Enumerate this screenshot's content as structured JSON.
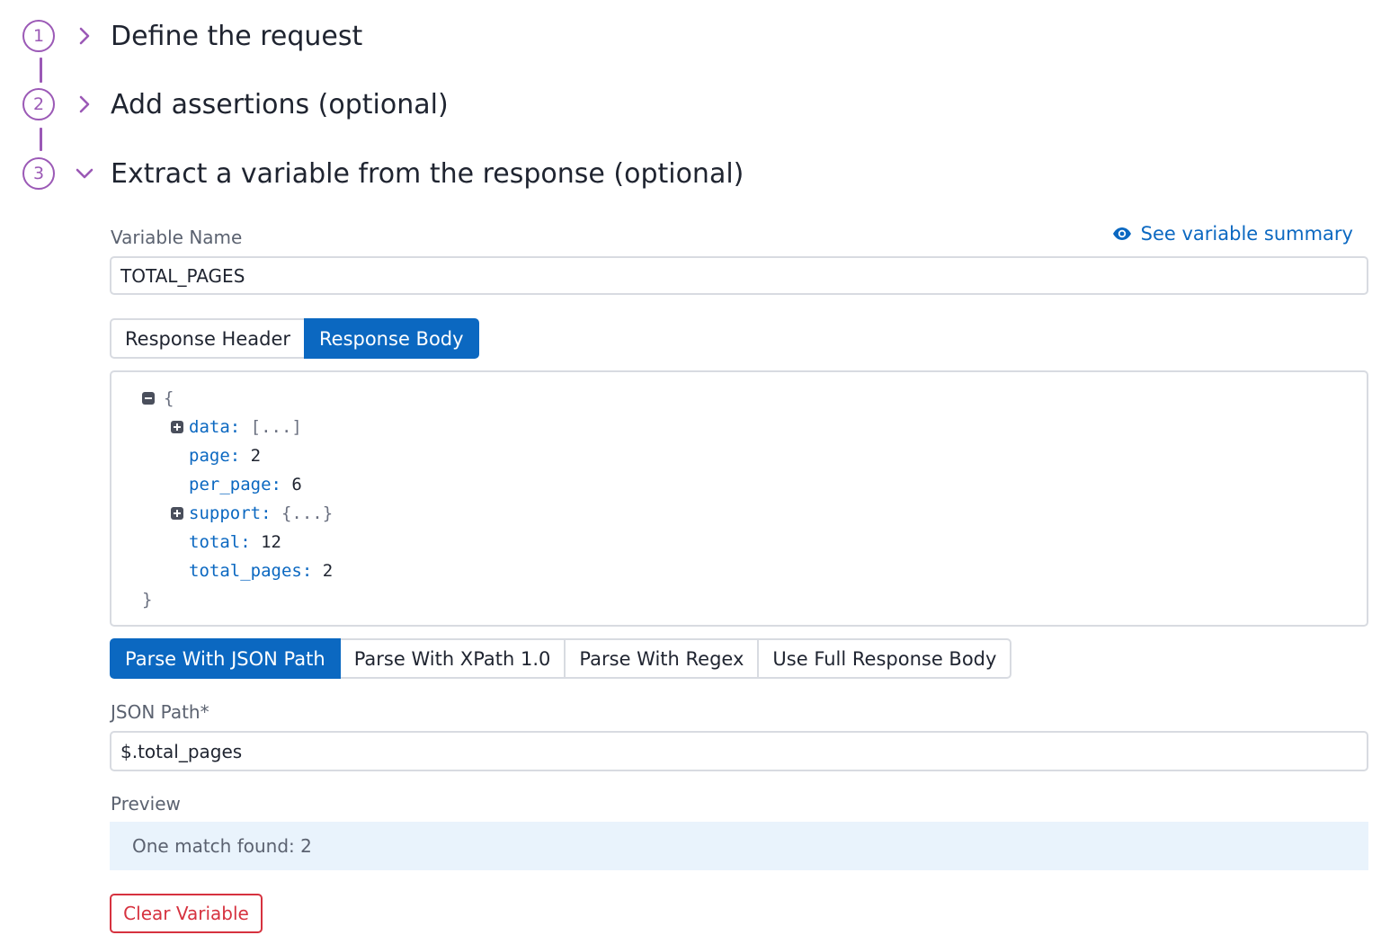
{
  "steps": [
    {
      "number": "1",
      "title": "Define the request",
      "expanded": false
    },
    {
      "number": "2",
      "title": "Add assertions (optional)",
      "expanded": false
    },
    {
      "number": "3",
      "title": "Extract a variable from the response (optional)",
      "expanded": true
    }
  ],
  "variable": {
    "label": "Variable Name",
    "value": "TOTAL_PAGES",
    "summary_link": "See variable summary"
  },
  "source_tabs": {
    "items": [
      "Response Header",
      "Response Body"
    ],
    "active": "Response Body"
  },
  "json_view": {
    "open_brace": "{",
    "close_brace": "}",
    "rows": [
      {
        "key": "data:",
        "value": "[...]",
        "collapsed": true
      },
      {
        "key": "page:",
        "value": "2"
      },
      {
        "key": "per_page:",
        "value": "6"
      },
      {
        "key": "support:",
        "value": "{...}",
        "collapsed": true
      },
      {
        "key": "total:",
        "value": "12"
      },
      {
        "key": "total_pages:",
        "value": "2"
      }
    ]
  },
  "parse_tabs": {
    "items": [
      "Parse With JSON Path",
      "Parse With XPath 1.0",
      "Parse With Regex",
      "Use Full Response Body"
    ],
    "active": "Parse With JSON Path"
  },
  "json_path": {
    "label": "JSON Path*",
    "value": "$.total_pages"
  },
  "preview": {
    "label": "Preview",
    "text": "One match found: 2"
  },
  "clear_button": "Clear Variable",
  "colors": {
    "accent_purple": "#9b59b6",
    "primary_blue": "#0b68c1",
    "danger_red": "#d6323f",
    "preview_bg": "#e9f3fc"
  }
}
